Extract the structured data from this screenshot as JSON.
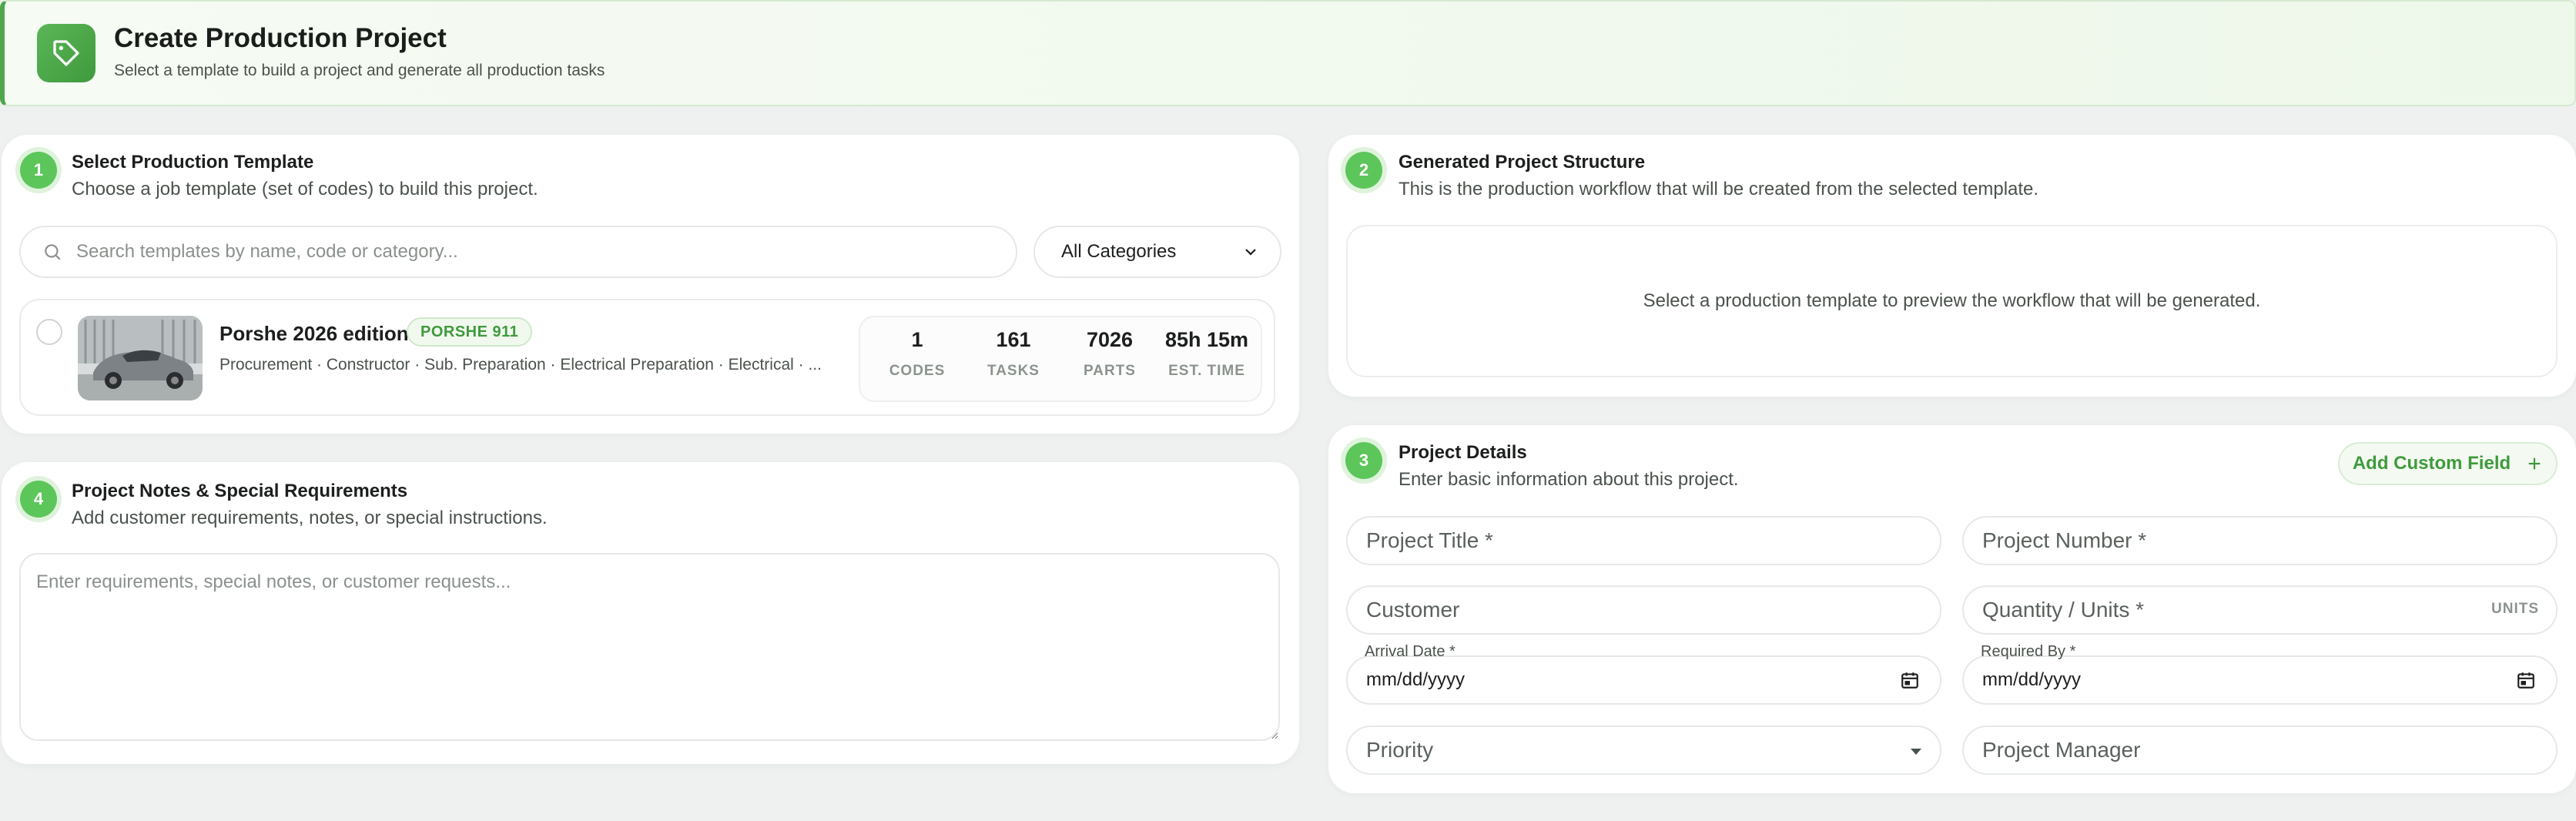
{
  "header": {
    "title": "Create Production Project",
    "subtitle": "Select a template to build a project and generate all production tasks"
  },
  "step1": {
    "number": "1",
    "title": "Select Production Template",
    "subtitle": "Choose a job template (set of codes) to build this project.",
    "search_placeholder": "Search templates by name, code or category...",
    "category_select": "All Categories",
    "templates": [
      {
        "name": "Porshe 2026 edition",
        "tag": "PORSHE 911",
        "categories": "Procurement · Constructor · Sub. Preparation · Electrical Preparation · Electrical · ...",
        "stats": [
          {
            "value": "1",
            "label": "CODES"
          },
          {
            "value": "161",
            "label": "TASKS"
          },
          {
            "value": "7026",
            "label": "PARTS"
          },
          {
            "value": "85h 15m",
            "label": "EST. TIME"
          }
        ]
      }
    ]
  },
  "step2": {
    "number": "2",
    "title": "Generated Project Structure",
    "subtitle": "This is the production workflow that will be created from the selected template.",
    "empty_message": "Select a production template to preview the workflow that will be generated."
  },
  "step3": {
    "number": "3",
    "title": "Project Details",
    "subtitle": "Enter basic information about this project.",
    "add_field_label": "Add Custom Field",
    "fields": {
      "project_title": "Project Title *",
      "project_number": "Project Number *",
      "customer": "Customer",
      "quantity": "Quantity / Units *",
      "units_suffix": "UNITS",
      "arrival_label": "Arrival Date *",
      "arrival_value": "mm/dd/yyyy",
      "required_label": "Required By *",
      "required_value": "mm/dd/yyyy",
      "priority": "Priority",
      "manager": "Project Manager"
    }
  },
  "step4": {
    "number": "4",
    "title": "Project Notes & Special Requirements",
    "subtitle": "Add customer requirements, notes, or special instructions.",
    "notes_placeholder": "Enter requirements, special notes, or customer requests..."
  },
  "colors": {
    "accent": "#4ea74a",
    "badge": "#5cc65a",
    "background": "#eef1ef"
  }
}
